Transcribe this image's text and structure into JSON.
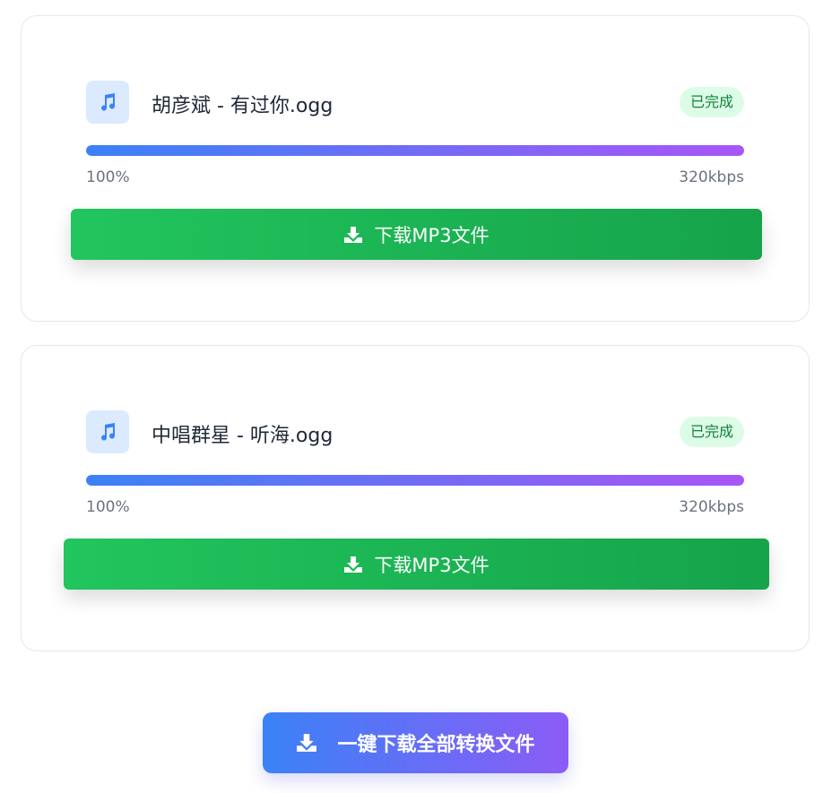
{
  "files": [
    {
      "name": "胡彦斌 - 有过你.ogg",
      "status": "已完成",
      "progress_text": "100%",
      "progress": 1.0,
      "bitrate": "320kbps",
      "download_label": "下载MP3文件",
      "icon": "music-note-icon"
    },
    {
      "name": "中唱群星 - 听海.ogg",
      "status": "已完成",
      "progress_text": "100%",
      "progress": 1.0,
      "bitrate": "320kbps",
      "download_label": "下载MP3文件",
      "icon": "music-note-icon"
    }
  ],
  "download_all_label": "一键下载全部转换文件",
  "colors": {
    "success": "#22c55e",
    "progress_start": "#3b82f6",
    "progress_end": "#a855f7",
    "accent_start": "#3b82f6",
    "accent_end": "#8b5cf6"
  }
}
